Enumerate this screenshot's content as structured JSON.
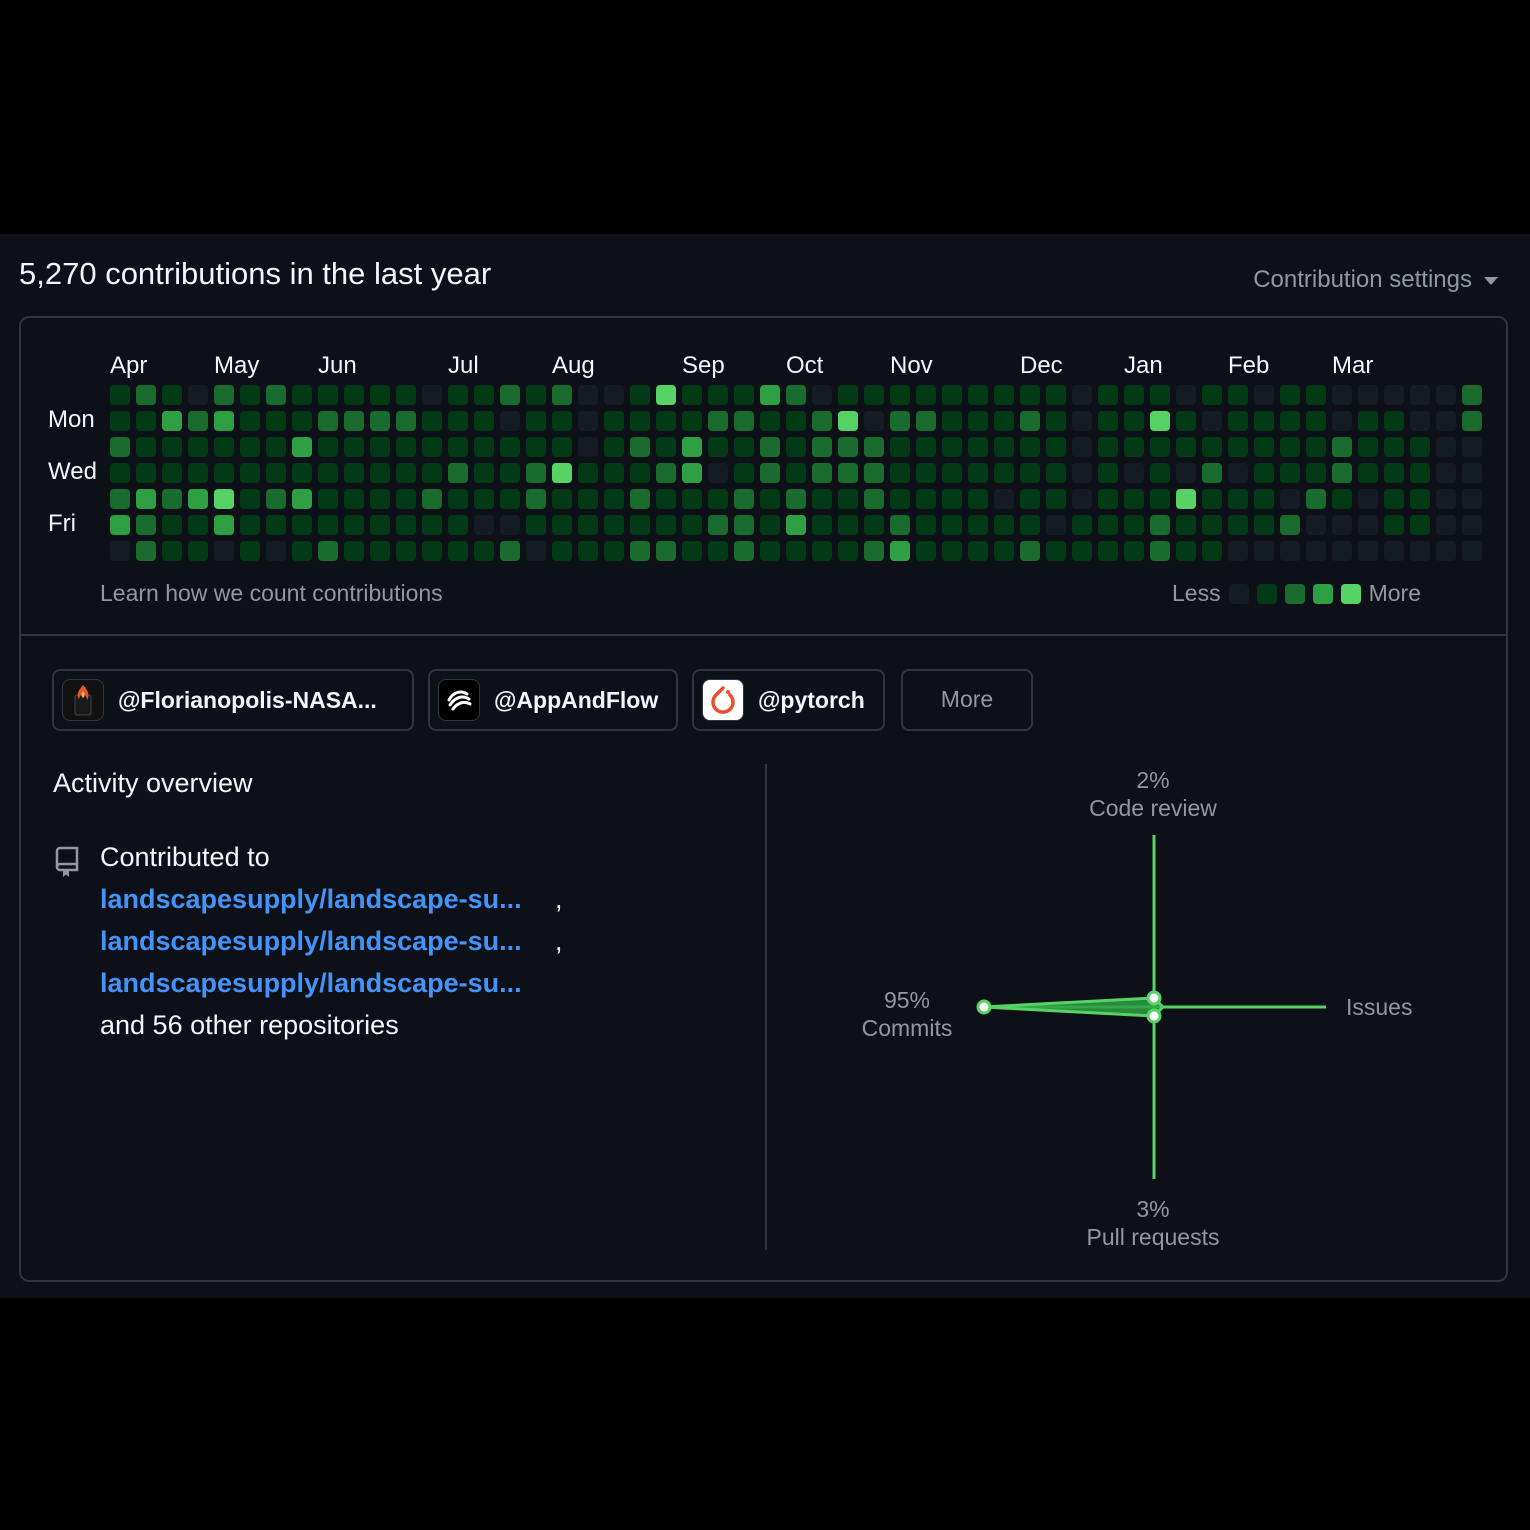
{
  "header": {
    "title": "5,270 contributions in the last year",
    "settings_label": "Contribution settings"
  },
  "calendar": {
    "months": [
      "Apr",
      "May",
      "Jun",
      "Jul",
      "Aug",
      "Sep",
      "Oct",
      "Nov",
      "Dec",
      "Jan",
      "Feb",
      "Mar"
    ],
    "day_labels": [
      "Mon",
      "Wed",
      "Fri"
    ],
    "learn_link": "Learn how we count contributions",
    "legend_less": "Less",
    "legend_more": "More",
    "level_colors": [
      "#151b23",
      "#033a16",
      "#196c2e",
      "#2ea043",
      "#56d364"
    ],
    "weeks": [
      [
        1,
        1,
        2,
        1,
        2,
        3,
        0
      ],
      [
        2,
        1,
        1,
        1,
        3,
        2,
        2
      ],
      [
        1,
        3,
        1,
        1,
        2,
        1,
        1
      ],
      [
        0,
        2,
        1,
        1,
        3,
        1,
        1
      ],
      [
        2,
        3,
        1,
        1,
        4,
        3,
        0
      ],
      [
        1,
        1,
        1,
        1,
        1,
        1,
        1
      ],
      [
        2,
        1,
        1,
        1,
        2,
        1,
        0
      ],
      [
        1,
        1,
        3,
        1,
        3,
        1,
        1
      ],
      [
        1,
        2,
        1,
        1,
        1,
        1,
        2
      ],
      [
        1,
        2,
        1,
        1,
        1,
        1,
        1
      ],
      [
        1,
        2,
        1,
        1,
        1,
        1,
        1
      ],
      [
        1,
        2,
        1,
        1,
        1,
        1,
        1
      ],
      [
        0,
        1,
        1,
        1,
        2,
        1,
        1
      ],
      [
        1,
        1,
        1,
        2,
        1,
        1,
        1
      ],
      [
        1,
        1,
        1,
        1,
        1,
        0,
        1
      ],
      [
        2,
        0,
        1,
        1,
        1,
        0,
        2
      ],
      [
        1,
        1,
        1,
        2,
        2,
        1,
        0
      ],
      [
        2,
        1,
        1,
        4,
        1,
        1,
        1
      ],
      [
        0,
        0,
        0,
        1,
        1,
        1,
        1
      ],
      [
        0,
        1,
        1,
        1,
        1,
        1,
        1
      ],
      [
        1,
        1,
        2,
        1,
        2,
        1,
        2
      ],
      [
        4,
        1,
        1,
        2,
        1,
        1,
        2
      ],
      [
        1,
        1,
        3,
        3,
        1,
        1,
        1
      ],
      [
        1,
        2,
        1,
        0,
        1,
        2,
        1
      ],
      [
        1,
        2,
        1,
        1,
        2,
        2,
        2
      ],
      [
        3,
        1,
        2,
        2,
        1,
        1,
        1
      ],
      [
        2,
        1,
        1,
        1,
        2,
        3,
        1
      ],
      [
        0,
        2,
        2,
        2,
        1,
        1,
        1
      ],
      [
        1,
        4,
        2,
        2,
        1,
        1,
        1
      ],
      [
        1,
        0,
        2,
        2,
        2,
        1,
        2
      ],
      [
        1,
        2,
        1,
        1,
        1,
        2,
        3
      ],
      [
        1,
        2,
        1,
        1,
        1,
        1,
        1
      ],
      [
        1,
        1,
        1,
        1,
        1,
        1,
        1
      ],
      [
        1,
        1,
        1,
        1,
        1,
        1,
        1
      ],
      [
        1,
        1,
        1,
        1,
        0,
        1,
        1
      ],
      [
        1,
        2,
        1,
        1,
        1,
        1,
        2
      ],
      [
        1,
        1,
        1,
        1,
        1,
        0,
        1
      ],
      [
        0,
        0,
        0,
        0,
        0,
        1,
        1
      ],
      [
        1,
        1,
        1,
        1,
        1,
        1,
        1
      ],
      [
        1,
        1,
        1,
        0,
        1,
        1,
        1
      ],
      [
        1,
        4,
        1,
        1,
        1,
        2,
        2
      ],
      [
        0,
        1,
        1,
        0,
        4,
        1,
        1
      ],
      [
        1,
        0,
        1,
        2,
        1,
        1,
        1
      ],
      [
        1,
        1,
        1,
        0,
        1,
        1,
        0
      ],
      [
        0,
        1,
        1,
        1,
        1,
        1,
        0
      ],
      [
        1,
        1,
        1,
        1,
        0,
        2,
        0
      ],
      [
        1,
        1,
        1,
        1,
        2,
        0,
        0
      ],
      [
        0,
        0,
        2,
        2,
        1,
        0,
        0
      ],
      [
        0,
        1,
        1,
        1,
        0,
        0,
        0
      ],
      [
        0,
        1,
        1,
        1,
        1,
        1,
        0
      ],
      [
        0,
        0,
        1,
        1,
        1,
        1,
        0
      ],
      [
        0,
        0,
        0,
        0,
        0,
        0,
        0
      ],
      [
        2,
        2,
        0,
        0,
        0,
        0,
        0
      ]
    ]
  },
  "orgs": [
    {
      "handle": "@Florianopolis-NASA...",
      "avatar_icon": "fire-icon"
    },
    {
      "handle": "@AppAndFlow",
      "avatar_icon": "appandflow-logo-icon"
    },
    {
      "handle": "@pytorch",
      "avatar_icon": "pytorch-logo-icon"
    }
  ],
  "orgs_more_label": "More",
  "activity": {
    "title": "Activity overview",
    "contributed_to": "Contributed to",
    "repos": [
      "landscapesupply/landscape-su...",
      "landscapesupply/landscape-su...",
      "landscapesupply/landscape-su..."
    ],
    "comma": ",",
    "others": "and 56 other repositories"
  },
  "chart_data": {
    "type": "radar",
    "axes": [
      {
        "name": "Code review",
        "percent_label": "2%",
        "value": 2
      },
      {
        "name": "Issues",
        "percent_label": "",
        "value": 0
      },
      {
        "name": "Pull requests",
        "percent_label": "3%",
        "value": 3
      },
      {
        "name": "Commits",
        "percent_label": "95%",
        "value": 95
      }
    ],
    "color": "#2ea043",
    "axis_color": "#56d364"
  }
}
